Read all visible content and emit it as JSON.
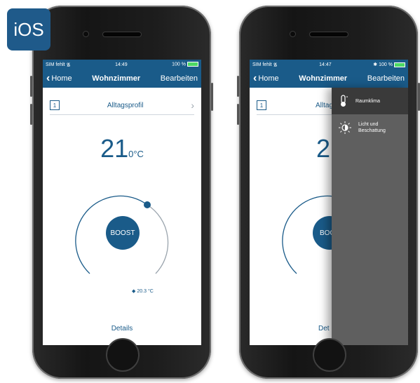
{
  "badge": "iOS",
  "phones": [
    {
      "status": {
        "carrier": "SIM fehlt",
        "time": "14:49",
        "battery": "100 %"
      },
      "nav": {
        "back": "Home",
        "title": "Wohnzimmer",
        "edit": "Bearbeiten"
      },
      "profile": {
        "number": "1",
        "label": "Alltagsprofil"
      },
      "temperature": {
        "value": "21",
        "unit": "0°C"
      },
      "boost_label": "BOOST",
      "measured": "20.3 °C",
      "details": "Details"
    },
    {
      "status": {
        "carrier": "SIM fehlt",
        "time": "14:47",
        "battery": "100 %"
      },
      "nav": {
        "back": "Home",
        "title": "Wohnzimmer",
        "edit": "Bearbeiten"
      },
      "profile": {
        "number": "1",
        "label": "Alltag"
      },
      "temperature": {
        "value": "21"
      },
      "boost_label": "BOO",
      "details": "Det",
      "menu": [
        {
          "label": "Raumklima",
          "icon": "thermometer-icon",
          "active": true
        },
        {
          "label": "Licht und Beschattung",
          "icon": "brightness-icon",
          "active": false
        }
      ]
    }
  ],
  "colors": {
    "primary": "#1a5b89",
    "overlay": "#5f5f5f",
    "menu_active": "#3a3a3a"
  }
}
